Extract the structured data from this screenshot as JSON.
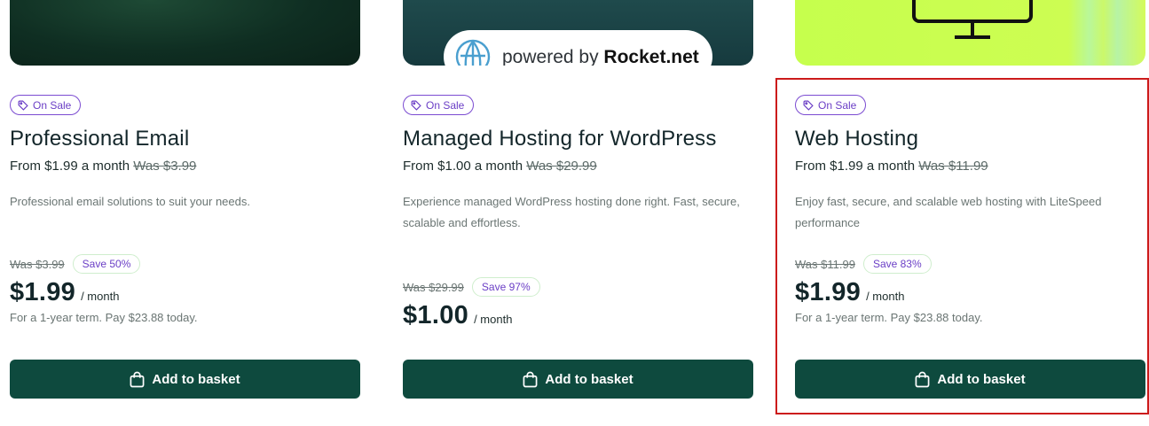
{
  "products": [
    {
      "badge": "On Sale",
      "title": "Professional Email",
      "from_text": "From $1.99 a month",
      "from_was": "Was $3.99",
      "description": "Professional email solutions to suit your needs.",
      "was_price": "Was $3.99",
      "save_label": "Save 50%",
      "price": "$1.99",
      "per": "/ month",
      "term": "For a 1-year term. Pay $23.88 today.",
      "button_label": "Add to basket"
    },
    {
      "badge": "On Sale",
      "title": "Managed Hosting for WordPress",
      "from_text": "From $1.00 a month",
      "from_was": "Was $29.99",
      "description": "Experience managed WordPress hosting done right. Fast, secure, scalable and effortless.",
      "was_price": "Was $29.99",
      "save_label": "Save 97%",
      "price": "$1.00",
      "per": "/ month",
      "term": "",
      "button_label": "Add to basket",
      "image_badge": {
        "powered_by": "powered by",
        "brand": "Rocket.net"
      }
    },
    {
      "badge": "On Sale",
      "title": "Web Hosting",
      "from_text": "From $1.99 a month",
      "from_was": "Was $11.99",
      "description": "Enjoy fast, secure, and scalable web hosting with LiteSpeed performance",
      "was_price": "Was $11.99",
      "save_label": "Save 83%",
      "price": "$1.99",
      "per": "/ month",
      "term": "For a 1-year term. Pay $23.88 today.",
      "button_label": "Add to basket"
    }
  ],
  "icons": {
    "badge": "tag-icon",
    "button": "shopping-bag-icon",
    "card_1_image": "rocket-logo-icon",
    "card_2_image": "monitor-icon"
  },
  "colors": {
    "button_bg": "#0e4a3e",
    "badge_accent": "#7b4bd1",
    "highlight": "#cc1b1b"
  }
}
